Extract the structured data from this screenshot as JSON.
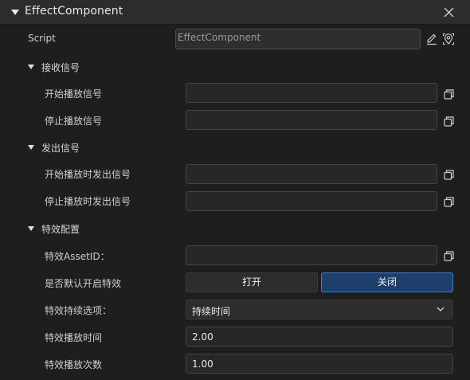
{
  "header": {
    "title": "EffectComponent"
  },
  "script": {
    "label": "Script",
    "value": "EffectComponent"
  },
  "sections": {
    "receive": {
      "title": "接收信号",
      "start_label": "开始播放信号",
      "start_value": "",
      "stop_label": "停止播放信号",
      "stop_value": ""
    },
    "emit": {
      "title": "发出信号",
      "start_label": "开始播放时发出信号",
      "start_value": "",
      "stop_label": "停止播放时发出信号",
      "stop_value": ""
    },
    "effect": {
      "title": "特效配置",
      "asset_label": "特效AssetID：",
      "asset_value": "",
      "default_on_label": "是否默认开启特效",
      "open_label": "打开",
      "close_label": "关闭",
      "duration_option_label": "特效持续选项：",
      "duration_option_value": "持续时间",
      "play_time_label": "特效播放时间",
      "play_time_value": "2.00",
      "play_count_label": "特效播放次数",
      "play_count_value": "1.00"
    }
  },
  "icons": {
    "collapse": "triangle-down-icon",
    "close": "close-icon",
    "edit": "pencil-icon",
    "locate": "locate-icon",
    "copy": "copy-icon",
    "dropdown": "chevron-down-icon"
  },
  "colors": {
    "selected_button_bg": "#1d3f6a",
    "selected_button_border": "#3c7fd1"
  }
}
